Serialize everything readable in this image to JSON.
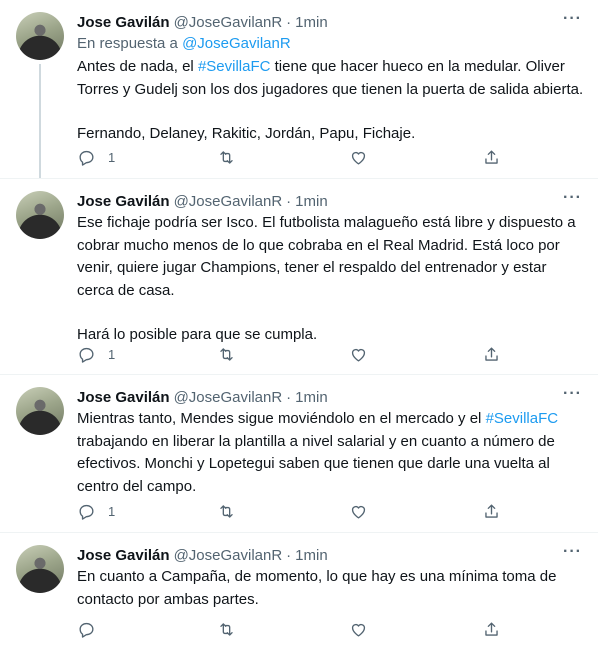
{
  "tweets": [
    {
      "author": {
        "name": "Jose Gavilán",
        "handle": "@JoseGavilanR"
      },
      "separator": "·",
      "time": "1min",
      "more_label": "···",
      "reply_to": {
        "prefix": "En respuesta a ",
        "handle": "@JoseGavilanR"
      },
      "text": {
        "line1_before": "Antes de nada, el ",
        "hashtag": "#SevillaFC",
        "line1_after": " tiene que hacer hueco en la medular. Oliver Torres y Gudelj son los dos jugadores que tienen la puerta de salida abierta.",
        "para2": "Fernando, Delaney, Rakitic, Jordán, Papu, Fichaje."
      },
      "reply_count": "1"
    },
    {
      "author": {
        "name": "Jose Gavilán",
        "handle": "@JoseGavilanR"
      },
      "separator": "·",
      "time": "1min",
      "more_label": "···",
      "text": {
        "para1": "Ese fichaje podría ser Isco. El futbolista malagueño está libre y dispuesto a cobrar mucho menos de lo que cobraba en el Real Madrid. Está loco por venir, quiere jugar Champions, tener el respaldo del entrenador y estar cerca de casa.",
        "para2": "Hará lo posible para que se cumpla."
      },
      "reply_count": "1"
    },
    {
      "author": {
        "name": "Jose Gavilán",
        "handle": "@JoseGavilanR"
      },
      "separator": "·",
      "time": "1min",
      "more_label": "···",
      "text": {
        "before": "Mientras tanto, Mendes sigue moviéndolo en el mercado y el ",
        "hashtag": "#SevillaFC",
        "after": " trabajando en liberar la plantilla a nivel salarial y en cuanto a número de efectivos. Monchi y Lopetegui saben que tienen que darle una vuelta al centro del campo."
      },
      "reply_count": "1"
    },
    {
      "author": {
        "name": "Jose Gavilán",
        "handle": "@JoseGavilanR"
      },
      "separator": "·",
      "time": "1min",
      "more_label": "···",
      "text": {
        "para1": "En cuanto a Campaña, de momento, lo que hay es una mínima toma de contacto por ambas partes."
      },
      "reply_count": ""
    }
  ],
  "icons": [
    "reply-icon",
    "retweet-icon",
    "like-icon",
    "share-icon",
    "more-icon",
    "avatar"
  ],
  "colors": {
    "link": "#1d9bf0",
    "secondary": "#536471",
    "text": "#0f1419",
    "thread_line": "#cfd9de"
  }
}
